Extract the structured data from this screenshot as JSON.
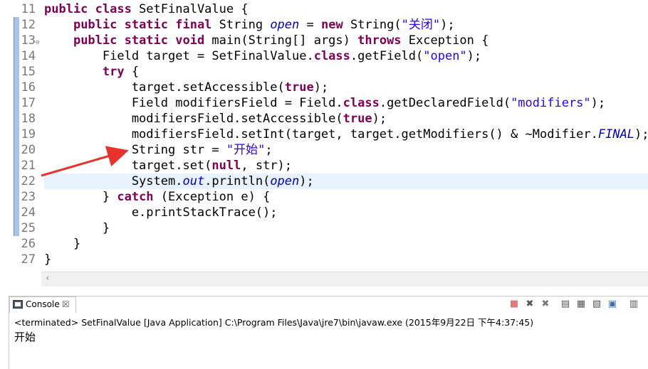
{
  "editor": {
    "line_numbers": [
      "11",
      "12",
      "13",
      "14",
      "15",
      "16",
      "17",
      "18",
      "19",
      "20",
      "21",
      "22",
      "23",
      "24",
      "25",
      "26",
      "27"
    ],
    "lines": [
      [
        {
          "t": "public class",
          "c": "kw"
        },
        {
          "t": " SetFinalValue {",
          "c": ""
        }
      ],
      [
        {
          "t": "    ",
          "c": ""
        },
        {
          "t": "public static final",
          "c": "kw"
        },
        {
          "t": " String ",
          "c": ""
        },
        {
          "t": "open",
          "c": "fld"
        },
        {
          "t": " = ",
          "c": ""
        },
        {
          "t": "new",
          "c": "kw"
        },
        {
          "t": " String(",
          "c": ""
        },
        {
          "t": "\"关闭\"",
          "c": "str"
        },
        {
          "t": ");",
          "c": ""
        }
      ],
      [
        {
          "t": "    ",
          "c": ""
        },
        {
          "t": "public static void",
          "c": "kw"
        },
        {
          "t": " main(String[] args) ",
          "c": ""
        },
        {
          "t": "throws",
          "c": "kw"
        },
        {
          "t": " Exception {",
          "c": ""
        }
      ],
      [
        {
          "t": "        Field target = SetFinalValue.",
          "c": ""
        },
        {
          "t": "class",
          "c": "kw"
        },
        {
          "t": ".getField(",
          "c": ""
        },
        {
          "t": "\"open\"",
          "c": "str"
        },
        {
          "t": ");",
          "c": ""
        }
      ],
      [
        {
          "t": "        ",
          "c": ""
        },
        {
          "t": "try",
          "c": "kw"
        },
        {
          "t": " {",
          "c": ""
        }
      ],
      [
        {
          "t": "            target.setAccessible(",
          "c": ""
        },
        {
          "t": "true",
          "c": "kw"
        },
        {
          "t": ");",
          "c": ""
        }
      ],
      [
        {
          "t": "            Field modifiersField = Field.",
          "c": ""
        },
        {
          "t": "class",
          "c": "kw"
        },
        {
          "t": ".getDeclaredField(",
          "c": ""
        },
        {
          "t": "\"modifiers\"",
          "c": "str"
        },
        {
          "t": ");",
          "c": ""
        }
      ],
      [
        {
          "t": "            modifiersField.setAccessible(",
          "c": ""
        },
        {
          "t": "true",
          "c": "kw"
        },
        {
          "t": ");",
          "c": ""
        }
      ],
      [
        {
          "t": "            modifiersField.setInt(target, target.getModifiers() & ~Modifier.",
          "c": ""
        },
        {
          "t": "FINAL",
          "c": "fld"
        },
        {
          "t": ");",
          "c": ""
        }
      ],
      [
        {
          "t": "            String str = ",
          "c": ""
        },
        {
          "t": "\"开始\"",
          "c": "str"
        },
        {
          "t": ";",
          "c": ""
        }
      ],
      [
        {
          "t": "            target.set(",
          "c": ""
        },
        {
          "t": "null",
          "c": "kw"
        },
        {
          "t": ", str);",
          "c": ""
        }
      ],
      [
        {
          "t": "            System.",
          "c": ""
        },
        {
          "t": "out",
          "c": "fld"
        },
        {
          "t": ".println(",
          "c": ""
        },
        {
          "t": "open",
          "c": "fld"
        },
        {
          "t": ");",
          "c": ""
        }
      ],
      [
        {
          "t": "        } ",
          "c": ""
        },
        {
          "t": "catch",
          "c": "kw"
        },
        {
          "t": " (Exception e) {",
          "c": ""
        }
      ],
      [
        {
          "t": "            e.printStackTrace();",
          "c": ""
        }
      ],
      [
        {
          "t": "        }",
          "c": ""
        }
      ],
      [
        {
          "t": "    }",
          "c": ""
        }
      ],
      [
        {
          "t": "}",
          "c": ""
        }
      ]
    ],
    "current_line": "22",
    "fold_marker": "⊖"
  },
  "console": {
    "tab_label": "Console",
    "tab_close": "☒",
    "terminated_text": "<terminated> SetFinalValue [Java Application] C:\\Program Files\\Java\\jre7\\bin\\javaw.exe (2015年9月22日 下午4:37:45)",
    "output": "开始",
    "toolbar": [
      {
        "name": "terminate-icon",
        "glyph": "■",
        "color": "#e07a7a"
      },
      {
        "name": "remove-launch-icon",
        "glyph": "✖",
        "color": "#555555"
      },
      {
        "name": "remove-all-terminated-icon",
        "glyph": "✖",
        "color": "#777777"
      },
      {
        "name": "scroll-lock-icon",
        "glyph": "▤",
        "color": "#555555"
      },
      {
        "name": "show-on-stdout-icon",
        "glyph": "▦",
        "color": "#555555"
      },
      {
        "name": "show-on-stderr-icon",
        "glyph": "▧",
        "color": "#555555"
      },
      {
        "name": "pin-console-icon",
        "glyph": "▣",
        "color": "#3a6fc0"
      },
      {
        "name": "display-selected-console-icon",
        "glyph": "▥",
        "color": "#555555"
      },
      {
        "name": "open-console-icon",
        "glyph": "✚",
        "color": "#3a8a3a"
      }
    ]
  },
  "annotation": {
    "arrow_color": "#e8322a"
  }
}
